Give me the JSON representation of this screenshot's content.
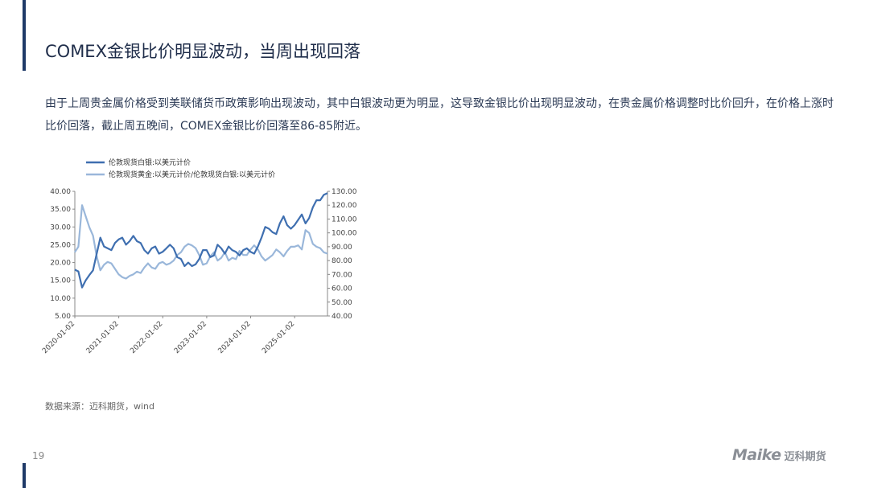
{
  "slide": {
    "title": "COMEX金银比价明显波动，当周出现回落",
    "body": "由于上周贵金属价格受到美联储货币政策影响出现波动，其中白银波动更为明显，这导致金银比价出现明显波动，在贵金属价格调整时比价回升，在价格上涨时比价回落，截止周五晚间，COMEX金银比价回落至86-85附近。",
    "source": "数据来源：迈科期货，wind",
    "page_number": "19",
    "logo": {
      "mark": "Maike",
      "text": "迈科期货"
    },
    "accent_color": "#1f3a68"
  },
  "chart_data": {
    "type": "line",
    "legend_position": "top-left",
    "grid": false,
    "x_ticks": [
      "2020-01-02",
      "2021-01-02",
      "2022-01-02",
      "2023-01-02",
      "2024-01-02",
      "2025-01-02"
    ],
    "y_left": {
      "ylim": [
        5,
        40
      ],
      "ticks": [
        "40.00",
        "35.00",
        "30.00",
        "25.00",
        "20.00",
        "15.00",
        "10.00",
        "5.00"
      ]
    },
    "y_right": {
      "ylim": [
        40,
        130
      ],
      "ticks": [
        "130.00",
        "120.00",
        "110.00",
        "100.00",
        "90.00",
        "80.00",
        "70.00",
        "60.00",
        "50.00",
        "40.00"
      ]
    },
    "series": [
      {
        "name": "伦敦现货白银:以美元计价",
        "axis": "left",
        "color": "#3f6fb0",
        "x": [
          "2020-01",
          "2020-02",
          "2020-03",
          "2020-04",
          "2020-05",
          "2020-06",
          "2020-07",
          "2020-08",
          "2020-09",
          "2020-10",
          "2020-11",
          "2020-12",
          "2021-01",
          "2021-02",
          "2021-03",
          "2021-04",
          "2021-05",
          "2021-06",
          "2021-07",
          "2021-08",
          "2021-09",
          "2021-10",
          "2021-11",
          "2021-12",
          "2022-01",
          "2022-02",
          "2022-03",
          "2022-04",
          "2022-05",
          "2022-06",
          "2022-07",
          "2022-08",
          "2022-09",
          "2022-10",
          "2022-11",
          "2022-12",
          "2023-01",
          "2023-02",
          "2023-03",
          "2023-04",
          "2023-05",
          "2023-06",
          "2023-07",
          "2023-08",
          "2023-09",
          "2023-10",
          "2023-11",
          "2023-12",
          "2024-01",
          "2024-02",
          "2024-03",
          "2024-04",
          "2024-05",
          "2024-06",
          "2024-07",
          "2024-08",
          "2024-09",
          "2024-10",
          "2024-11",
          "2024-12",
          "2025-01",
          "2025-02",
          "2025-03",
          "2025-04",
          "2025-05",
          "2025-06",
          "2025-07",
          "2025-08",
          "2025-09",
          "2025-10"
        ],
        "values": [
          18.0,
          17.5,
          13.0,
          15.0,
          16.5,
          17.8,
          22.5,
          27.0,
          24.5,
          24.0,
          23.5,
          25.5,
          26.5,
          27.0,
          25.0,
          26.0,
          27.5,
          26.0,
          25.5,
          23.5,
          22.5,
          24.0,
          24.5,
          22.5,
          23.0,
          24.0,
          25.0,
          24.0,
          21.5,
          21.0,
          19.0,
          20.0,
          19.0,
          19.5,
          21.0,
          23.5,
          23.5,
          21.5,
          22.0,
          25.0,
          24.0,
          22.5,
          24.5,
          23.5,
          23.0,
          22.0,
          23.5,
          24.0,
          23.0,
          22.5,
          24.5,
          27.0,
          30.0,
          29.5,
          28.5,
          28.0,
          31.0,
          33.0,
          30.5,
          29.5,
          30.5,
          32.0,
          33.5,
          31.0,
          32.5,
          35.5,
          37.5,
          37.5,
          39.0,
          39.5
        ]
      },
      {
        "name": "伦敦现货黄金:以美元计价/伦敦现货白银:以美元计价",
        "axis": "right",
        "color": "#9ab7da",
        "x": [
          "2020-01",
          "2020-02",
          "2020-03",
          "2020-04",
          "2020-05",
          "2020-06",
          "2020-07",
          "2020-08",
          "2020-09",
          "2020-10",
          "2020-11",
          "2020-12",
          "2021-01",
          "2021-02",
          "2021-03",
          "2021-04",
          "2021-05",
          "2021-06",
          "2021-07",
          "2021-08",
          "2021-09",
          "2021-10",
          "2021-11",
          "2021-12",
          "2022-01",
          "2022-02",
          "2022-03",
          "2022-04",
          "2022-05",
          "2022-06",
          "2022-07",
          "2022-08",
          "2022-09",
          "2022-10",
          "2022-11",
          "2022-12",
          "2023-01",
          "2023-02",
          "2023-03",
          "2023-04",
          "2023-05",
          "2023-06",
          "2023-07",
          "2023-08",
          "2023-09",
          "2023-10",
          "2023-11",
          "2023-12",
          "2024-01",
          "2024-02",
          "2024-03",
          "2024-04",
          "2024-05",
          "2024-06",
          "2024-07",
          "2024-08",
          "2024-09",
          "2024-10",
          "2024-11",
          "2024-12",
          "2025-01",
          "2025-02",
          "2025-03",
          "2025-04",
          "2025-05",
          "2025-06",
          "2025-07",
          "2025-08",
          "2025-09",
          "2025-10"
        ],
        "values": [
          86,
          90,
          120,
          112,
          104,
          98,
          83,
          73,
          77,
          79,
          78,
          74,
          70,
          68,
          67,
          69,
          70,
          72,
          71,
          75,
          78,
          75,
          74,
          78,
          79,
          77,
          78,
          80,
          84,
          86,
          90,
          92,
          91,
          89,
          84,
          77,
          78,
          83,
          86,
          80,
          82,
          86,
          80,
          82,
          81,
          87,
          84,
          84,
          88,
          91,
          88,
          83,
          80,
          82,
          84,
          88,
          86,
          83,
          87,
          90,
          90,
          91,
          88,
          102,
          100,
          92,
          90,
          89,
          86,
          85
        ]
      }
    ]
  }
}
